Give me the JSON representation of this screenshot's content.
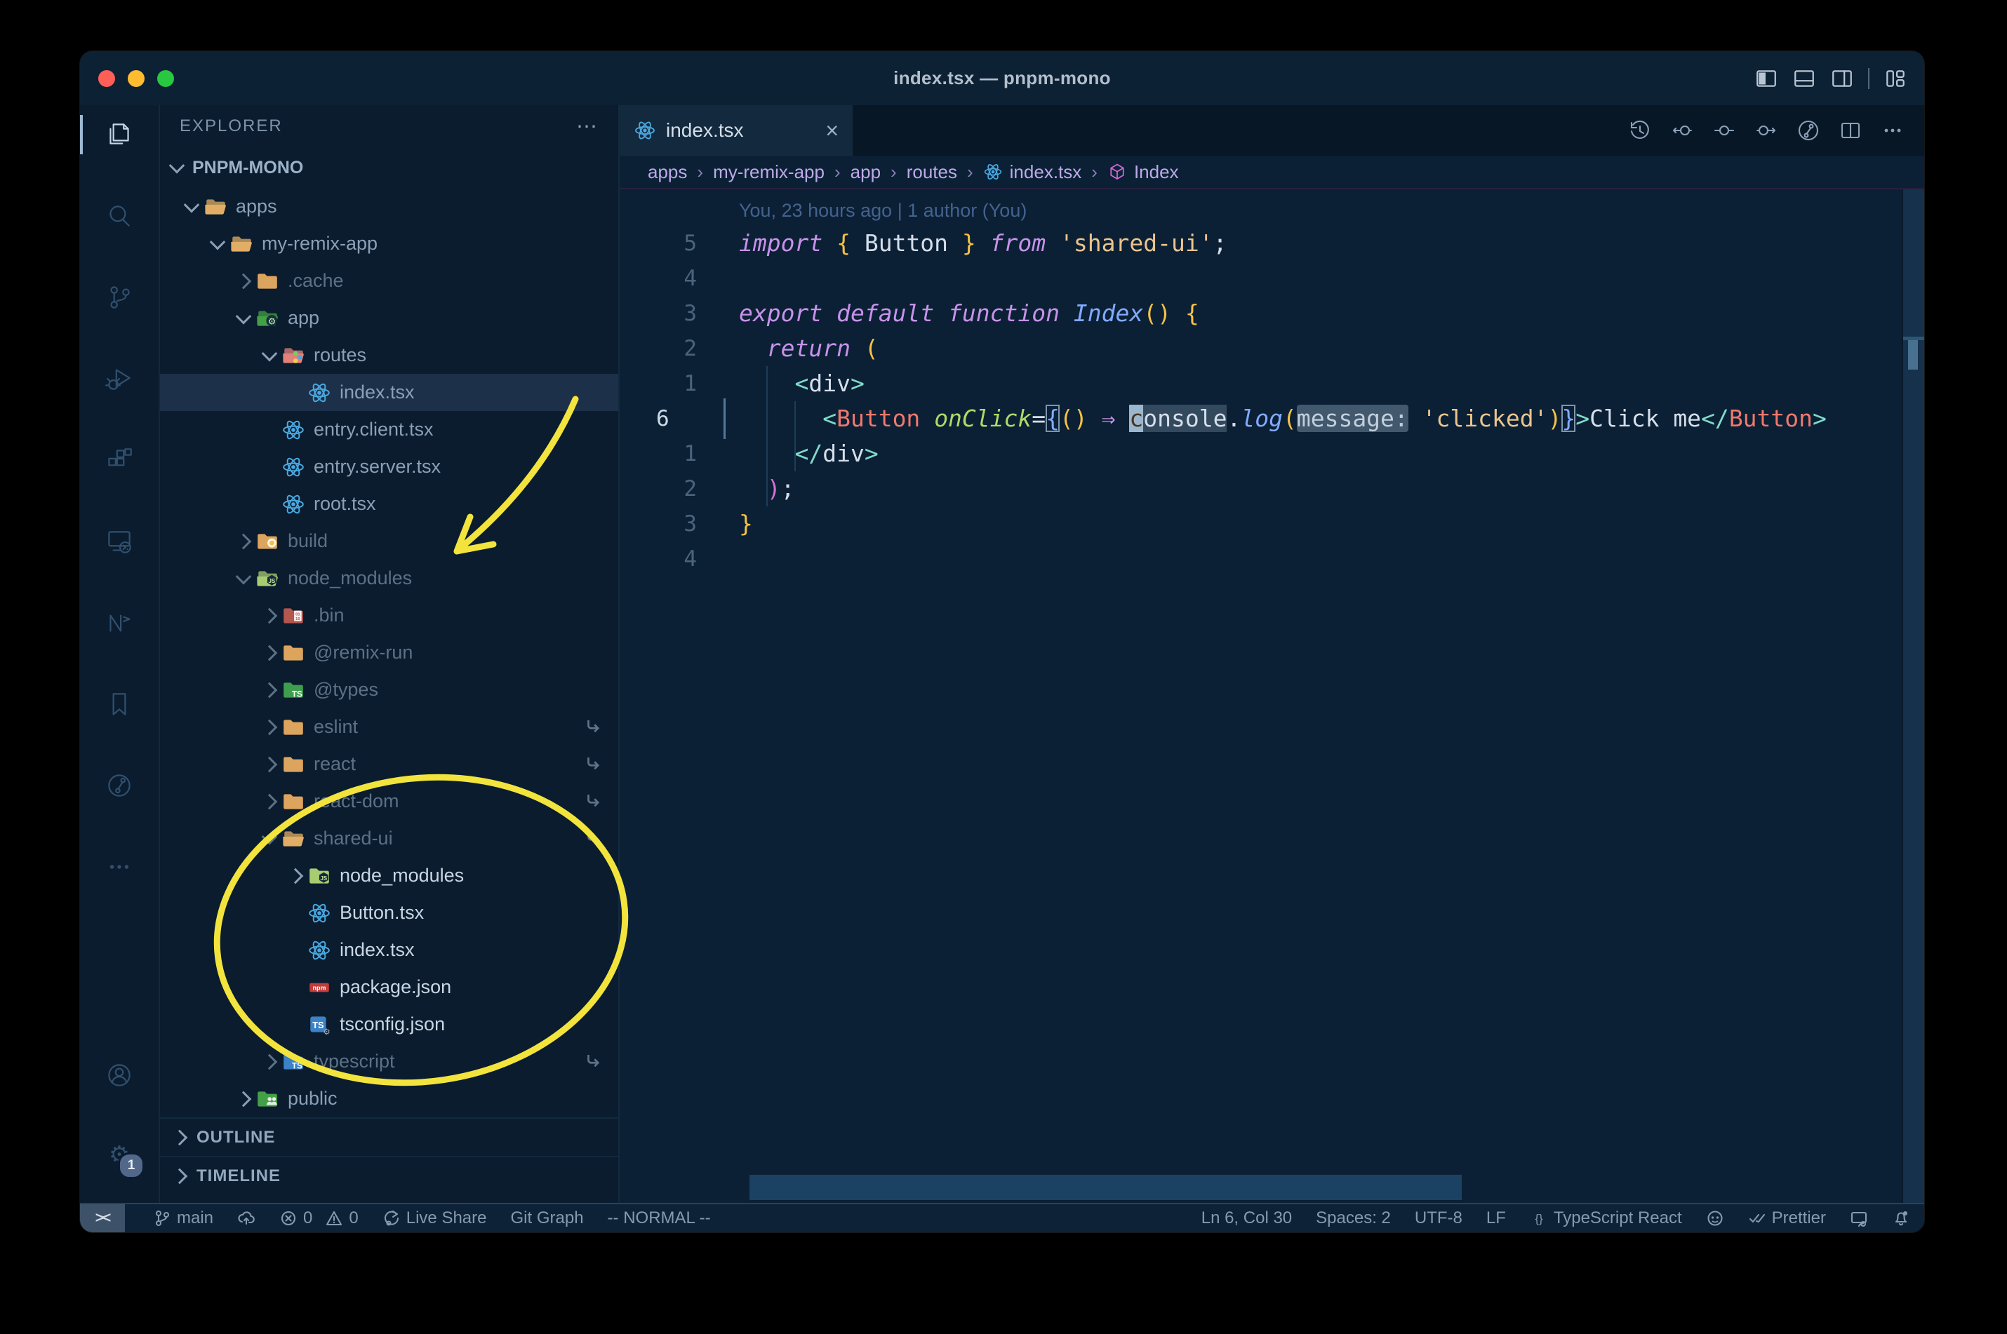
{
  "window": {
    "title": "index.tsx — pnpm-mono"
  },
  "titlebar": {
    "right_icons": [
      "toggle-primary-sidebar",
      "toggle-panel",
      "toggle-secondary-sidebar",
      "separator",
      "customize-layout"
    ]
  },
  "activity_bar": {
    "top": [
      {
        "icon": "explorer",
        "active": true
      },
      {
        "icon": "search"
      },
      {
        "icon": "source-control"
      },
      {
        "icon": "run-debug"
      },
      {
        "icon": "extensions"
      },
      {
        "icon": "remote-explorer"
      },
      {
        "icon": "nx-console"
      },
      {
        "icon": "bookmarks"
      },
      {
        "icon": "git-graph"
      },
      {
        "icon": "more"
      }
    ],
    "bottom": [
      {
        "icon": "account"
      },
      {
        "icon": "settings",
        "badge": "1"
      }
    ]
  },
  "sidebar": {
    "header": "EXPLORER",
    "header_more": "⋯",
    "section": "PNPM-MONO",
    "tree": [
      {
        "label": "apps",
        "icon": "fo",
        "level": 0,
        "chevron": "open"
      },
      {
        "label": "my-remix-app",
        "icon": "fo",
        "level": 1,
        "chevron": "open"
      },
      {
        "label": ".cache",
        "icon": "f",
        "level": 2,
        "chevron": "closed",
        "dim": true
      },
      {
        "label": "app",
        "icon": "f-app",
        "level": 2,
        "chevron": "open"
      },
      {
        "label": "routes",
        "icon": "f-routes",
        "level": 3,
        "chevron": "open"
      },
      {
        "label": "index.tsx",
        "icon": "react",
        "level": 4,
        "chevron": "none",
        "selected": true
      },
      {
        "label": "entry.client.tsx",
        "icon": "react",
        "level": 3,
        "chevron": "none"
      },
      {
        "label": "entry.server.tsx",
        "icon": "react",
        "level": 3,
        "chevron": "none"
      },
      {
        "label": "root.tsx",
        "icon": "react",
        "level": 3,
        "chevron": "none"
      },
      {
        "label": "build",
        "icon": "f-build",
        "level": 2,
        "chevron": "closed",
        "dim": true
      },
      {
        "label": "node_modules",
        "icon": "f-nm-open",
        "level": 2,
        "chevron": "open",
        "dim": true
      },
      {
        "label": ".bin",
        "icon": "f-bin",
        "level": 3,
        "chevron": "closed",
        "dim": true
      },
      {
        "label": "@remix-run",
        "icon": "f",
        "level": 3,
        "chevron": "closed",
        "dim": true
      },
      {
        "label": "@types",
        "icon": "f-types",
        "level": 3,
        "chevron": "closed",
        "dim": true
      },
      {
        "label": "eslint",
        "icon": "f",
        "level": 3,
        "chevron": "closed",
        "dim": true,
        "symlink": true
      },
      {
        "label": "react",
        "icon": "f",
        "level": 3,
        "chevron": "closed",
        "dim": true,
        "symlink": true
      },
      {
        "label": "react-dom",
        "icon": "f",
        "level": 3,
        "chevron": "closed",
        "dim": true,
        "symlink": true
      },
      {
        "label": "shared-ui",
        "icon": "fo",
        "level": 3,
        "chevron": "open",
        "dim": true,
        "symlink": true
      },
      {
        "label": "node_modules",
        "icon": "f-nm",
        "level": 4,
        "chevron": "closed",
        "bright": true
      },
      {
        "label": "Button.tsx",
        "icon": "react",
        "level": 4,
        "chevron": "none",
        "bright": true
      },
      {
        "label": "index.tsx",
        "icon": "react",
        "level": 4,
        "chevron": "none",
        "bright": true
      },
      {
        "label": "package.json",
        "icon": "npm",
        "level": 4,
        "chevron": "none",
        "bright": true
      },
      {
        "label": "tsconfig.json",
        "icon": "ts-gear",
        "level": 4,
        "chevron": "none",
        "bright": true
      },
      {
        "label": "typescript",
        "icon": "f-ts",
        "level": 3,
        "chevron": "closed",
        "dim": true,
        "symlink": true
      },
      {
        "label": "public",
        "icon": "f-public",
        "level": 2,
        "chevron": "closed"
      }
    ],
    "panels": [
      "OUTLINE",
      "TIMELINE"
    ]
  },
  "tabs": {
    "active": {
      "label": "index.tsx",
      "icon": "react",
      "close": "×"
    },
    "actions": [
      "timeline-history",
      "nav-back",
      "nav-current",
      "nav-forward",
      "git-branch-circle",
      "split-editor",
      "more-actions"
    ]
  },
  "breadcrumbs": [
    {
      "label": "apps"
    },
    {
      "label": "my-remix-app"
    },
    {
      "label": "app"
    },
    {
      "label": "routes"
    },
    {
      "label": "index.tsx",
      "icon": "react"
    },
    {
      "label": "Index",
      "icon": "symbol-cube"
    }
  ],
  "editor": {
    "blame": "You, 23 hours ago | 1 author (You)",
    "lines": [
      {
        "gutter": "5",
        "tokens": [
          [
            "kw",
            "import"
          ],
          [
            "pl",
            " "
          ],
          [
            "gold",
            "{"
          ],
          [
            "pl",
            " Button "
          ],
          [
            "gold",
            "}"
          ],
          [
            "pl",
            " "
          ],
          [
            "kw",
            "from"
          ],
          [
            "pl",
            " "
          ],
          [
            "str",
            "'shared-ui'"
          ],
          [
            "pl",
            ";"
          ]
        ]
      },
      {
        "gutter": "4",
        "tokens": []
      },
      {
        "gutter": "3",
        "tokens": [
          [
            "kw",
            "export"
          ],
          [
            "pl",
            " "
          ],
          [
            "kw",
            "default"
          ],
          [
            "pl",
            " "
          ],
          [
            "kw",
            "function"
          ],
          [
            "pl",
            " "
          ],
          [
            "fnb",
            "Index"
          ],
          [
            "gold",
            "()"
          ],
          [
            "pl",
            " "
          ],
          [
            "gold",
            "{"
          ]
        ]
      },
      {
        "gutter": "2",
        "tokens": [
          [
            "pl",
            "  "
          ],
          [
            "kw",
            "return"
          ],
          [
            "pl",
            " "
          ],
          [
            "gold",
            "("
          ]
        ]
      },
      {
        "gutter": "1",
        "tokens": [
          [
            "pl",
            "    "
          ],
          [
            "ang",
            "<"
          ],
          [
            "pl",
            "div"
          ],
          [
            "ang",
            ">"
          ]
        ]
      },
      {
        "gutter": "6",
        "current": true,
        "tokens": [
          [
            "pl",
            "      "
          ],
          [
            "ang",
            "<"
          ],
          [
            "comp",
            "Button"
          ],
          [
            "pl",
            " "
          ],
          [
            "attr",
            "onClick"
          ],
          [
            "pl",
            "="
          ],
          [
            "bbox",
            "{"
          ],
          [
            "gold",
            "()"
          ],
          [
            "pl",
            " "
          ],
          [
            "arrow",
            "⇒"
          ],
          [
            "pl",
            " "
          ],
          [
            "cursor",
            "c"
          ],
          [
            "hl",
            "onsole"
          ],
          [
            "pl",
            "."
          ],
          [
            "fnb",
            "log"
          ],
          [
            "gold",
            "("
          ],
          [
            "inlay",
            "message:"
          ],
          [
            "pl",
            " "
          ],
          [
            "str",
            "'clicked'"
          ],
          [
            "gold",
            ")"
          ],
          [
            "bbox",
            "}"
          ],
          [
            "ang",
            ">"
          ],
          [
            "pl",
            "Click me"
          ],
          [
            "ang",
            "</"
          ],
          [
            "comp",
            "Button"
          ],
          [
            "ang",
            ">"
          ]
        ]
      },
      {
        "gutter": "1",
        "tokens": [
          [
            "pl",
            "    "
          ],
          [
            "ang",
            "</"
          ],
          [
            "pl",
            "div"
          ],
          [
            "ang",
            ">"
          ]
        ]
      },
      {
        "gutter": "2",
        "tokens": [
          [
            "pl",
            "  "
          ],
          [
            "pink",
            ")"
          ],
          [
            "pl",
            ";"
          ]
        ]
      },
      {
        "gutter": "3",
        "tokens": [
          [
            "gold",
            "}"
          ]
        ]
      },
      {
        "gutter": "4",
        "tokens": []
      }
    ]
  },
  "status_bar": {
    "left": [
      {
        "name": "remote-indicator",
        "icon": "remote",
        "label": "><"
      },
      {
        "name": "branch",
        "icon": "git-branch",
        "label": "main"
      },
      {
        "name": "sync",
        "icon": "cloud-upload",
        "label": ""
      },
      {
        "name": "problems",
        "icon": "error-circle",
        "label": "0",
        "icon2": "warning-triangle",
        "label2": "0"
      },
      {
        "name": "live-share",
        "icon": "live-share",
        "label": "Live Share"
      },
      {
        "name": "git-graph",
        "label": "Git Graph"
      },
      {
        "name": "vim-mode",
        "label": "-- NORMAL --"
      }
    ],
    "right": [
      {
        "name": "cursor-position",
        "label": "Ln 6, Col 30"
      },
      {
        "name": "indentation",
        "label": "Spaces: 2"
      },
      {
        "name": "encoding",
        "label": "UTF-8"
      },
      {
        "name": "eol",
        "label": "LF"
      },
      {
        "name": "language-mode",
        "icon": "braces",
        "label": "TypeScript React"
      },
      {
        "name": "github",
        "icon": "github",
        "label": ""
      },
      {
        "name": "prettier",
        "icon": "double-check",
        "label": "Prettier"
      },
      {
        "name": "live-share-contact",
        "icon": "person-screen",
        "label": ""
      },
      {
        "name": "notifications",
        "icon": "bell-dot",
        "label": ""
      }
    ]
  },
  "annotations": {
    "color": "#f2e43c"
  },
  "colors": {
    "traffic": [
      "#ff5f57",
      "#febc2e",
      "#28c840"
    ],
    "selection_row": "#1c3049",
    "accent_yellow": "#f2e43c"
  }
}
